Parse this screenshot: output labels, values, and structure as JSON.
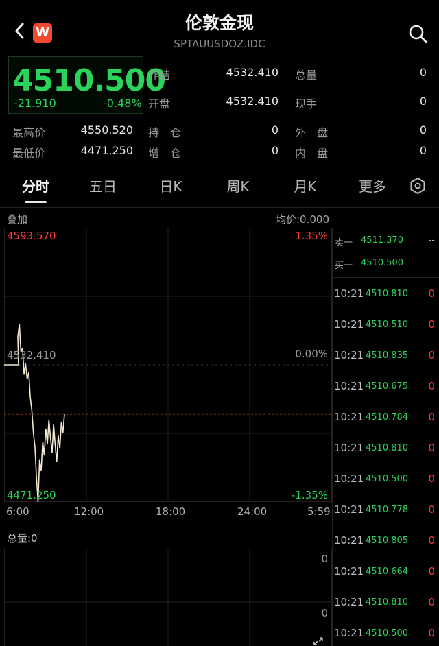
{
  "header": {
    "title": "伦敦金现",
    "code": "SPTAUUSDOZ.IDC",
    "logo_text": "W"
  },
  "quote": {
    "price": "4510.500",
    "change": "-21.910",
    "change_pct": "-0.48%",
    "prev_close_label": "昨结",
    "prev_close": "4532.410",
    "open_label": "开盘",
    "open": "4532.410",
    "total_vol_label": "总量",
    "total_vol": "0",
    "cur_vol_label": "现手",
    "cur_vol": "0",
    "high_label": "最高价",
    "high": "4550.520",
    "low_label": "最低价",
    "low": "4471.250",
    "position_label": "持　仓",
    "position": "0",
    "add_pos_label": "增　仓",
    "add_pos": "0",
    "outer_label": "外　盘",
    "outer": "0",
    "inner_label": "内　盘",
    "inner": "0"
  },
  "tabs": [
    "分时",
    "五日",
    "日K",
    "周K",
    "月K",
    "更多"
  ],
  "chart": {
    "overlay_label": "叠加",
    "avg_label": "均价:0.000",
    "top_price": "4593.570",
    "top_pct": "1.35%",
    "mid_price": "4532.410",
    "mid_pct": "0.00%",
    "bottom_price": "4471.250",
    "bottom_pct": "-1.35%",
    "time_labels": [
      "6:00",
      "12:00",
      "18:00",
      "24:00",
      "5:59"
    ],
    "volume_label": "总量:0",
    "vol_top": "0",
    "vol_mid": "0",
    "colors": {
      "up": "#ff3b3b",
      "down": "#2bd35a",
      "line": "#f3e9d2",
      "current_line": "#ff5a2a"
    }
  },
  "chart_data": {
    "type": "line",
    "title": "",
    "ylim": [
      4471.25,
      4593.57
    ],
    "y_ref": 4532.41,
    "x_label_ticks": [
      "6:00",
      "12:00",
      "18:00",
      "24:00",
      "5:59"
    ],
    "series": [
      {
        "values": [
          4532.41,
          4532.41,
          4532.41,
          4532.41,
          4545.0,
          4550.52,
          4538.0,
          4540.0,
          4528.0,
          4533.0,
          4526.0,
          4529.0,
          4518.0,
          4512.0,
          4502.0,
          4496.0,
          4482.0,
          4471.25,
          4490.0,
          4485.0,
          4498.0,
          4492.0,
          4504.0,
          4497.0,
          4508.0,
          4500.0,
          4493.0,
          4506.0,
          4497.0,
          4489.0,
          4501.0,
          4495.0,
          4507.0,
          4502.0,
          4510.5
        ]
      }
    ],
    "current_price": 4510.5
  },
  "order_book": {
    "sell_label": "卖一",
    "sell_price": "4511.370",
    "sell_vol": "--",
    "buy_label": "买一",
    "buy_price": "4510.500",
    "buy_vol": "--"
  },
  "ticks": [
    {
      "time": "10:21",
      "price": "4510.810",
      "vol": "0"
    },
    {
      "time": "10:21",
      "price": "4510.510",
      "vol": "0"
    },
    {
      "time": "10:21",
      "price": "4510.835",
      "vol": "0"
    },
    {
      "time": "10:21",
      "price": "4510.675",
      "vol": "0"
    },
    {
      "time": "10:21",
      "price": "4510.784",
      "vol": "0"
    },
    {
      "time": "10:21",
      "price": "4510.810",
      "vol": "0"
    },
    {
      "time": "10:21",
      "price": "4510.500",
      "vol": "0"
    },
    {
      "time": "10:21",
      "price": "4510.778",
      "vol": "0"
    },
    {
      "time": "10:21",
      "price": "4510.805",
      "vol": "0"
    },
    {
      "time": "10:21",
      "price": "4510.664",
      "vol": "0"
    },
    {
      "time": "10:21",
      "price": "4510.810",
      "vol": "0"
    },
    {
      "time": "10:21",
      "price": "4510.500",
      "vol": "0"
    }
  ]
}
